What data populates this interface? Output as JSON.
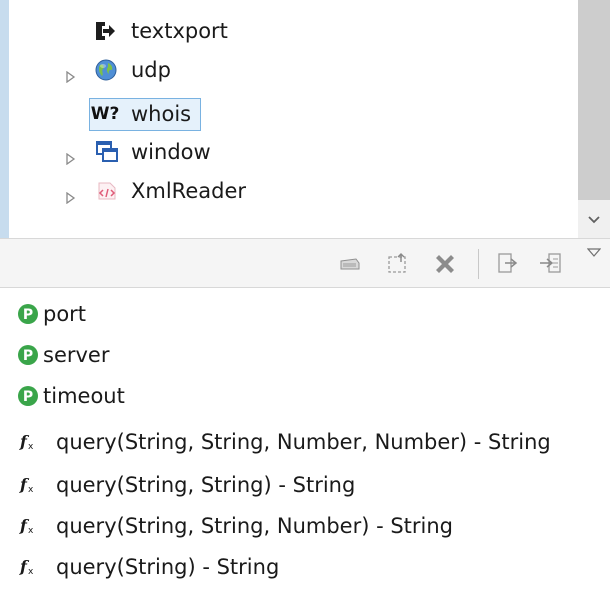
{
  "tree": {
    "items": [
      {
        "label": "textxport",
        "icon": "export-arrow-icon",
        "expandable": false
      },
      {
        "label": "udp",
        "icon": "globe-icon",
        "expandable": true
      },
      {
        "label": "whois",
        "icon": "whois-icon",
        "icon_text": "W?",
        "expandable": false,
        "selected": true
      },
      {
        "label": "window",
        "icon": "window-icon",
        "expandable": true
      },
      {
        "label": "XmlReader",
        "icon": "xml-icon",
        "icon_text": "</>",
        "expandable": true
      }
    ]
  },
  "toolbar": {
    "buttons": [
      "clear-icon",
      "collapse-icon",
      "delete-icon",
      "export-icon",
      "import-icon",
      "view-menu-icon"
    ]
  },
  "members": [
    {
      "label": "port",
      "icon": "property-icon",
      "icon_text": "P"
    },
    {
      "label": "server",
      "icon": "property-icon",
      "icon_text": "P"
    },
    {
      "label": "timeout",
      "icon": "property-icon",
      "icon_text": "P"
    },
    {
      "label": "query(String, String, Number, Number) - String",
      "icon": "function-icon",
      "icon_text": "f"
    },
    {
      "label": "query(String, String) - String",
      "icon": "function-icon",
      "icon_text": "f"
    },
    {
      "label": "query(String, String, Number) - String",
      "icon": "function-icon",
      "icon_text": "f"
    },
    {
      "label": "query(String) - String",
      "icon": "function-icon",
      "icon_text": "f"
    }
  ],
  "colors": {
    "selection_bg": "#e5f1fb",
    "selection_border": "#79b2e1",
    "property_green": "#3aa54a",
    "tree_left_border": "#c7dcee"
  }
}
